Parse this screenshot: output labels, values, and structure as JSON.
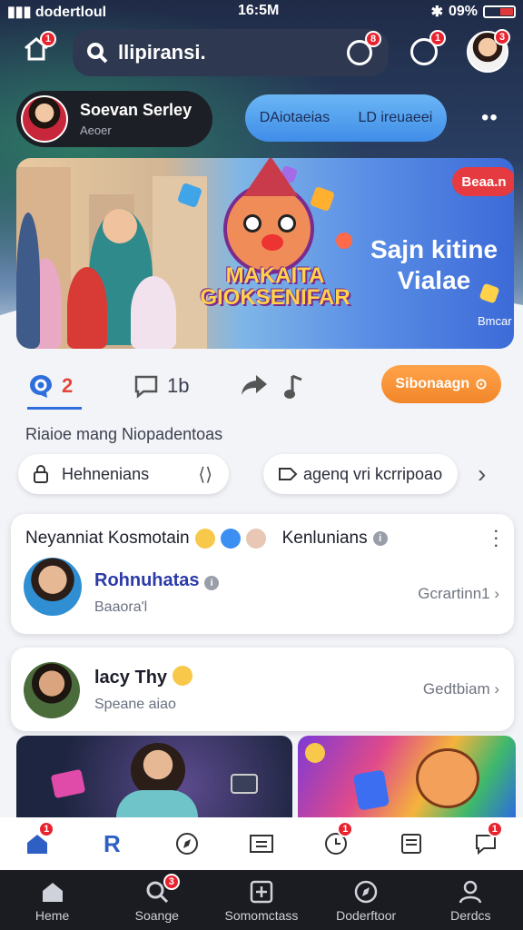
{
  "status": {
    "carrier": "dodertloul",
    "time": "16:5M",
    "battery": "09%"
  },
  "header": {
    "search_text": "llipiransi.",
    "home_badge": "1",
    "search_badge": "8",
    "timer_badge": "1",
    "avatar_badge": "3"
  },
  "profile": {
    "name": "Soevan Serley",
    "sub": "Aeoer"
  },
  "top_tabs": [
    "DAiotaeias",
    "LD ireuaeei"
  ],
  "banner": {
    "badge": "Beaa.n",
    "title_line1": "MAKAITA",
    "title_line2": "GIOKSENIFAR",
    "headline_line1": "Sajn kitine",
    "headline_line2": "Vialae",
    "small": "Bmcar"
  },
  "actions": {
    "comments": "2",
    "messages": "1b",
    "follow": "Sibonaagn"
  },
  "section_title": "Riaioe mang Niopadentoas",
  "chips": {
    "chip1": "Hehnenians",
    "chip2": "agenq vri kcrripoao"
  },
  "card1": {
    "title_left": "Neyanniat Kosmotain",
    "title_right": "Kenlunians",
    "name": "Rohnuhatas",
    "sub": "Baaora'l",
    "link": "Gcrartinn1"
  },
  "card2": {
    "name": "lacy Thy",
    "sub": "Speane aiao",
    "link": "Gedtbiam"
  },
  "subnav_badges": [
    "1",
    "1",
    "1"
  ],
  "bottom_nav": [
    "Heme",
    "Soange",
    "Somomctass",
    "Doderftoor",
    "Derdcs"
  ],
  "bottom_badge": "3",
  "colors": {
    "accent": "#2f6fdc",
    "badge": "#e8232f",
    "follow": "#f2862a",
    "bottom_bg": "#1b1c21"
  }
}
